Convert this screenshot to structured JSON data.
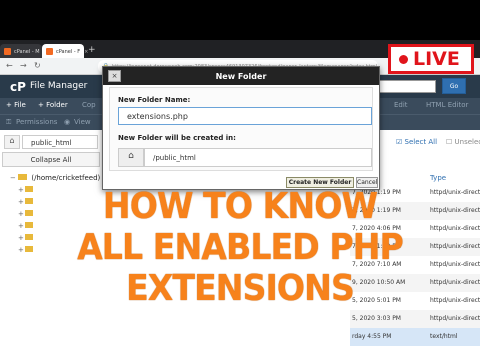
{
  "browser": {
    "tabs": [
      {
        "label": "cPanel - M",
        "close": "×"
      },
      {
        "label": "cPanel - F",
        "close": "×"
      },
      {
        "label": "+"
      }
    ],
    "url": "https://ingecnet.doroseweb.com:2083/cpsess4691307326/frontend/paper_lantern/filemanager/index.html"
  },
  "cpanel": {
    "logo": "cP",
    "title": "File Manager",
    "go_label": "Go"
  },
  "toolbar": {
    "file": "+ File",
    "folder": "+ Folder",
    "copy": "Cop",
    "edit": "Edit",
    "html_editor": "HTML Editor",
    "permissions": "Permissions",
    "view": "View"
  },
  "sidebar": {
    "path": "public_html",
    "collapse_label": "Collapse All",
    "root_label": "(/home/cricketfeed)",
    "rows": 6
  },
  "listing": {
    "select_all": "Select All",
    "unselect": "Unselect",
    "type_header": "Type",
    "rows": [
      {
        "date": "7, 2020 1:19 PM",
        "type": "httpd/unix-direct"
      },
      {
        "date": "7, 2020 1:19 PM",
        "type": "httpd/unix-direct"
      },
      {
        "date": "7, 2020 4:06 PM",
        "type": "httpd/unix-direct"
      },
      {
        "date": "7, 2020 1:19 PM",
        "type": "httpd/unix-direct"
      },
      {
        "date": "7, 2020 7:10 AM",
        "type": "httpd/unix-direct"
      },
      {
        "date": "9, 2020 10:50 AM",
        "type": "httpd/unix-direct"
      },
      {
        "date": "5, 2020 5:01 PM",
        "type": "httpd/unix-direct"
      },
      {
        "date": "5, 2020 3:03 PM",
        "type": "httpd/unix-direct"
      },
      {
        "date": "rday 4:55 PM",
        "type": "text/html"
      }
    ]
  },
  "modal": {
    "title": "New Folder",
    "close": "×",
    "name_label": "New Folder Name:",
    "name_value": "extensions.php",
    "location_label": "New Folder will be created in:",
    "location_value": "/public_html",
    "create_label": "Create New Folder",
    "cancel_label": "Cancel"
  },
  "badge": {
    "text": "LIVE",
    "color": "#e0141b"
  },
  "overlay": {
    "line1": "HOW TO KNOW",
    "line2": "ALL ENABLED PHP",
    "line3": "EXTENSIONS",
    "color": "#f7821b"
  }
}
